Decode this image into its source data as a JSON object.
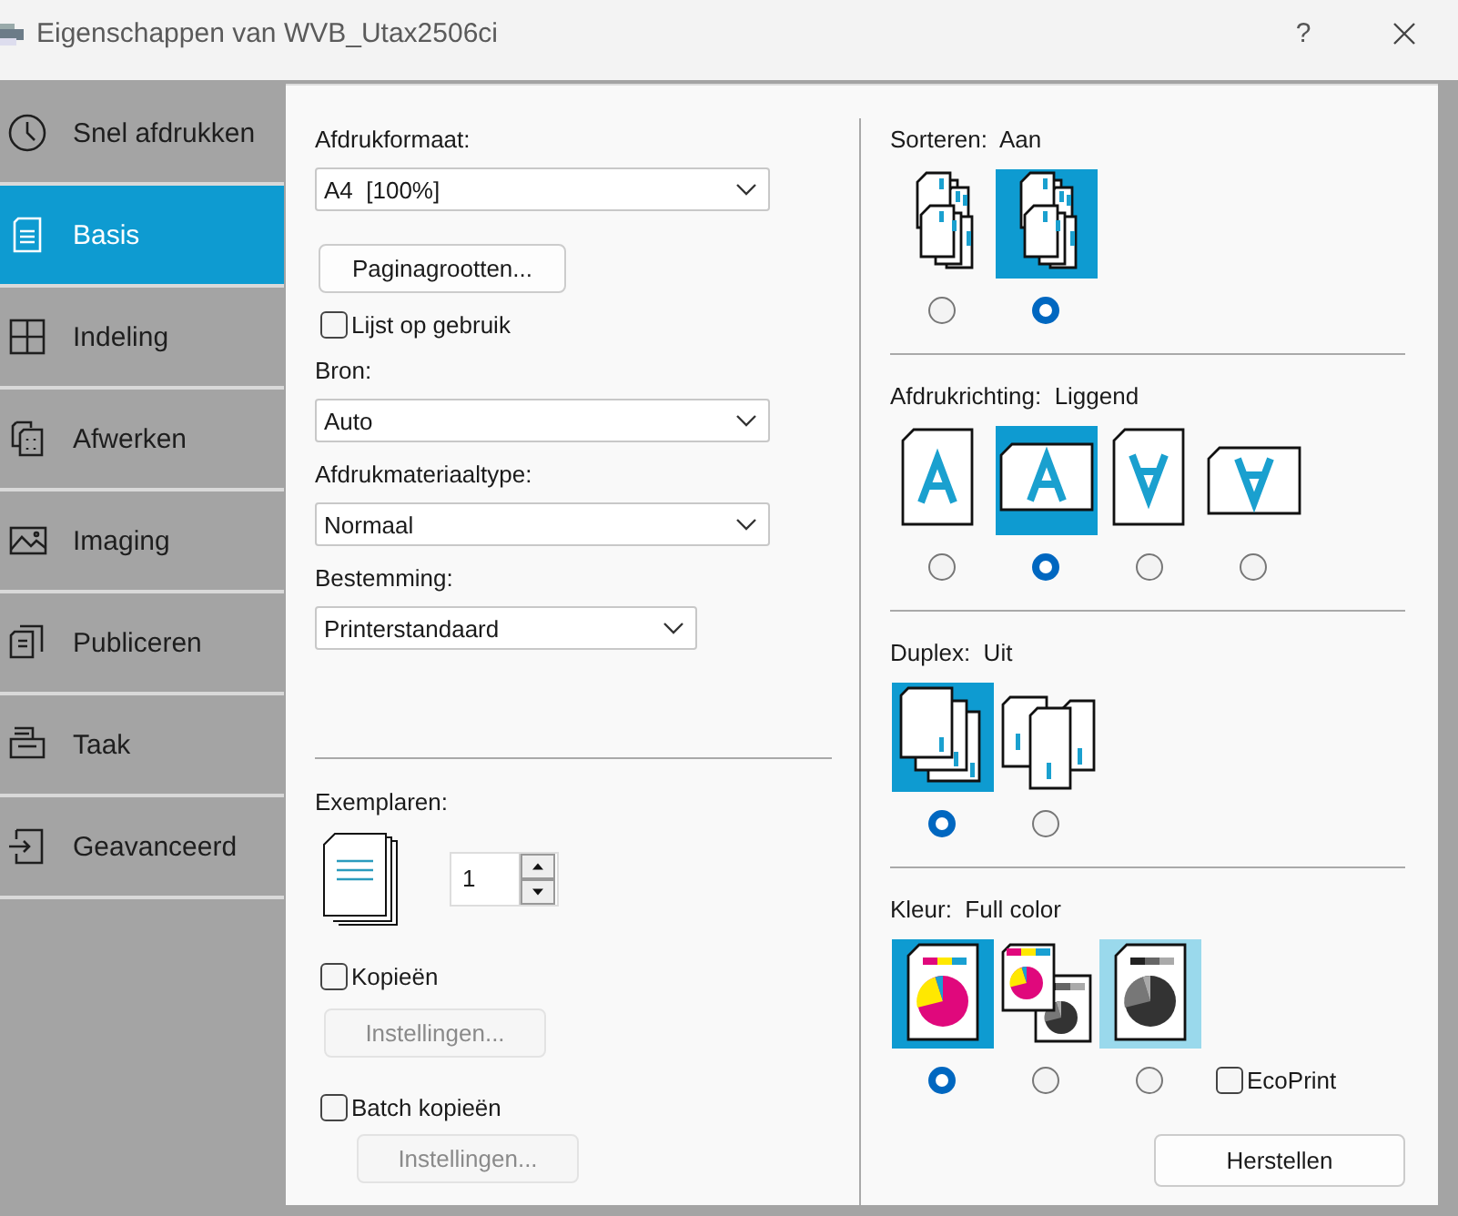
{
  "window": {
    "title": "Eigenschappen van WVB_Utax2506ci",
    "help": "?"
  },
  "sidebar": {
    "items": [
      {
        "label": "Snel afdrukken",
        "selected": false
      },
      {
        "label": "Basis",
        "selected": true
      },
      {
        "label": "Indeling",
        "selected": false
      },
      {
        "label": "Afwerken",
        "selected": false
      },
      {
        "label": "Imaging",
        "selected": false
      },
      {
        "label": "Publiceren",
        "selected": false
      },
      {
        "label": "Taak",
        "selected": false
      },
      {
        "label": "Geavanceerd",
        "selected": false
      }
    ]
  },
  "basic": {
    "fields": [
      {
        "kind": "dropdown",
        "label": "Afdrukformaat:",
        "value": "A4  [100%]"
      },
      {
        "kind": "button",
        "label": "Paginagrootten..."
      },
      {
        "kind": "checkbox",
        "label": "Lijst op gebruik",
        "checked": false
      },
      {
        "kind": "dropdown",
        "label": "Bron:",
        "value": "Auto"
      },
      {
        "kind": "dropdown",
        "label": "Afdrukmateriaaltype:",
        "value": "Normaal"
      },
      {
        "kind": "dropdown",
        "label": "Bestemming:",
        "value": "Printerstandaard"
      }
    ],
    "copies": {
      "label": "Exemplaren:",
      "value": "1"
    },
    "options": [
      {
        "kind": "checkbox",
        "label": "Kopieën",
        "checked": false
      },
      {
        "kind": "button",
        "label": "Instellingen...",
        "disabled": true
      },
      {
        "kind": "checkbox",
        "label": "Batch kopieën",
        "checked": false
      },
      {
        "kind": "button",
        "label": "Instellingen...",
        "disabled": true
      }
    ]
  },
  "settings": {
    "groups": [
      {
        "kind": "collate",
        "label": "Sorteren:",
        "value": "Aan",
        "options": [
          {
            "selected": false
          },
          {
            "selected": true
          }
        ]
      },
      {
        "kind": "orientation",
        "label": "Afdrukrichting:",
        "value": "Liggend",
        "options": [
          {
            "selected": false
          },
          {
            "selected": true
          },
          {
            "selected": false
          },
          {
            "selected": false
          }
        ]
      },
      {
        "kind": "duplex",
        "label": "Duplex:",
        "value": "Uit",
        "options": [
          {
            "selected": true
          },
          {
            "selected": false
          }
        ]
      },
      {
        "kind": "color",
        "label": "Kleur:",
        "value": "Full color",
        "options": [
          {
            "selected": true,
            "highlighted": false
          },
          {
            "selected": false,
            "highlighted": false
          },
          {
            "selected": false,
            "highlighted": true
          }
        ]
      }
    ],
    "ecoprint": {
      "label": "EcoPrint",
      "checked": false
    },
    "reset_button": "Herstellen"
  }
}
